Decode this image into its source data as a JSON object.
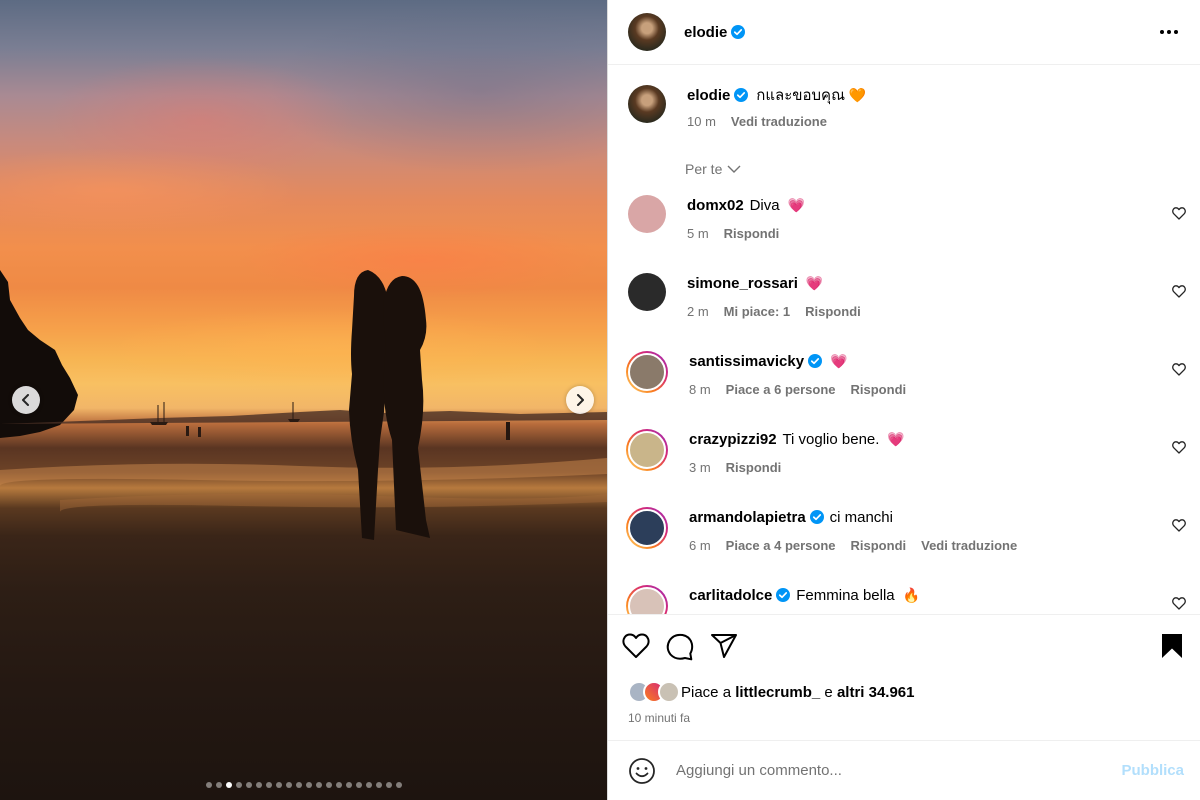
{
  "post": {
    "author": "elodie",
    "caption": "กและขอบคุณ",
    "caption_emoji": "🧡",
    "time": "10 m",
    "see_translation": "Vedi traduzione",
    "carousel": {
      "total": 20,
      "active_index": 2
    }
  },
  "sort": {
    "label": "Per te"
  },
  "comments": [
    {
      "user": "domx02",
      "verified": false,
      "text": "Diva",
      "emoji": "💗",
      "time": "5 m",
      "likes": "",
      "reply": "Rispondi",
      "translate": "",
      "story_ring": false,
      "avatar_color": "#d9a6a6"
    },
    {
      "user": "simone_rossari",
      "verified": false,
      "text": "",
      "emoji": "💗",
      "time": "2 m",
      "likes": "Mi piace: 1",
      "reply": "Rispondi",
      "translate": "",
      "story_ring": false,
      "avatar_color": "#2a2a2a"
    },
    {
      "user": "santissimavicky",
      "verified": true,
      "text": "",
      "emoji": "💗",
      "time": "8 m",
      "likes": "Piace a 6 persone",
      "reply": "Rispondi",
      "translate": "",
      "story_ring": true,
      "avatar_color": "#8a7a6a"
    },
    {
      "user": "crazypizzi92",
      "verified": false,
      "text": "Ti voglio bene.",
      "emoji": "💗",
      "time": "3 m",
      "likes": "",
      "reply": "Rispondi",
      "translate": "",
      "story_ring": true,
      "avatar_color": "#c9b58a"
    },
    {
      "user": "armandolapietra",
      "verified": true,
      "text": "ci manchi",
      "emoji": "",
      "time": "6 m",
      "likes": "Piace a 4 persone",
      "reply": "Rispondi",
      "translate": "Vedi traduzione",
      "story_ring": true,
      "avatar_color": "#2c3e5a"
    },
    {
      "user": "carlitadolce",
      "verified": true,
      "text": "Femmina bella",
      "emoji": "🔥",
      "time": "",
      "likes": "",
      "reply": "",
      "translate": "",
      "story_ring": true,
      "avatar_color": "#d8c2b8"
    }
  ],
  "likes": {
    "prefix": "Piace a",
    "first_user": "littlecrumb_",
    "connector": "e",
    "others": "altri 34.961",
    "posted_ago": "10 minuti fa"
  },
  "composer": {
    "placeholder": "Aggiungi un commento...",
    "publish_label": "Pubblica"
  },
  "colors": {
    "verified": "#0095f6",
    "secondary_text": "#737373",
    "publish_disabled": "#b2dffc",
    "heart_pink": "#ff3366"
  }
}
